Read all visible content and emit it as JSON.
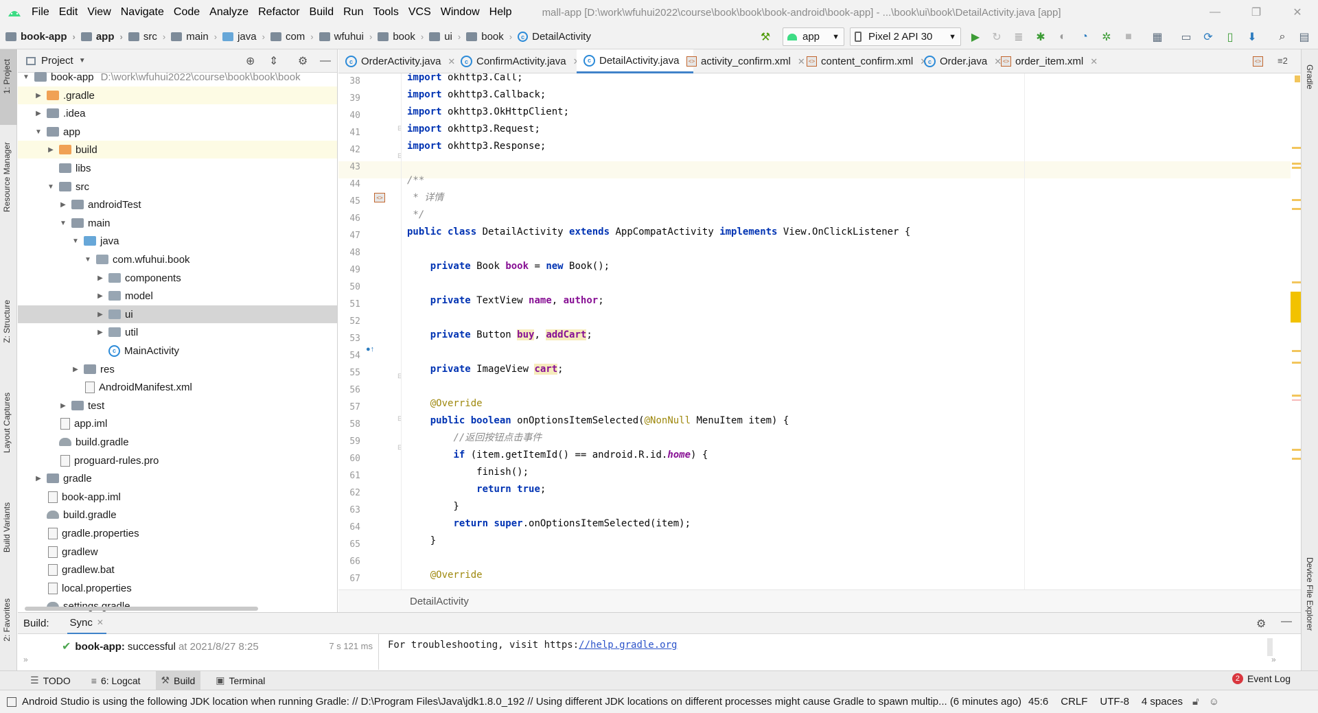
{
  "menu": {
    "items": [
      "File",
      "Edit",
      "View",
      "Navigate",
      "Code",
      "Analyze",
      "Refactor",
      "Build",
      "Run",
      "Tools",
      "VCS",
      "Window",
      "Help"
    ],
    "window_title": "mall-app [D:\\work\\wfuhui2022\\course\\book\\book\\book-android\\book-app] - ...\\book\\ui\\book\\DetailActivity.java [app]"
  },
  "navbar": {
    "crumbs": [
      "book-app",
      "app",
      "src",
      "main",
      "java",
      "com",
      "wfuhui",
      "book",
      "ui",
      "book",
      "DetailActivity"
    ],
    "run_config": "app",
    "device": "Pixel 2 API 30"
  },
  "left_stripe": {
    "tabs": [
      "1: Project",
      "Resource Manager",
      "Z: Structure",
      "Layout Captures",
      "Build Variants",
      "2: Favorites"
    ]
  },
  "right_stripe": {
    "tabs": [
      "Gradle",
      "Device File Explorer"
    ]
  },
  "project": {
    "title": "Project",
    "tree": [
      {
        "label": "book-app",
        "path": "D:\\work\\wfuhui2022\\course\\book\\book\\book",
        "depth": 0,
        "arrow": "open",
        "icon": "folder"
      },
      {
        "label": ".gradle",
        "depth": 1,
        "arrow": "closed",
        "icon": "folder-orange",
        "hl": "yellow"
      },
      {
        "label": ".idea",
        "depth": 1,
        "arrow": "closed",
        "icon": "folder"
      },
      {
        "label": "app",
        "depth": 1,
        "arrow": "open",
        "icon": "folder"
      },
      {
        "label": "build",
        "depth": 2,
        "arrow": "closed",
        "icon": "folder-orange",
        "hl": "yellow"
      },
      {
        "label": "libs",
        "depth": 2,
        "arrow": "none",
        "icon": "folder"
      },
      {
        "label": "src",
        "depth": 2,
        "arrow": "open",
        "icon": "folder"
      },
      {
        "label": "androidTest",
        "depth": 3,
        "arrow": "closed",
        "icon": "folder"
      },
      {
        "label": "main",
        "depth": 3,
        "arrow": "open",
        "icon": "folder"
      },
      {
        "label": "java",
        "depth": 4,
        "arrow": "open",
        "icon": "folder-blue"
      },
      {
        "label": "com.wfuhui.book",
        "depth": 5,
        "arrow": "open",
        "icon": "package"
      },
      {
        "label": "components",
        "depth": 6,
        "arrow": "closed",
        "icon": "package"
      },
      {
        "label": "model",
        "depth": 6,
        "arrow": "closed",
        "icon": "package"
      },
      {
        "label": "ui",
        "depth": 6,
        "arrow": "closed",
        "icon": "package",
        "hl": "selected"
      },
      {
        "label": "util",
        "depth": 6,
        "arrow": "closed",
        "icon": "package"
      },
      {
        "label": "MainActivity",
        "depth": 6,
        "arrow": "none",
        "icon": "class"
      },
      {
        "label": "res",
        "depth": 4,
        "arrow": "closed",
        "icon": "folder"
      },
      {
        "label": "AndroidManifest.xml",
        "depth": 4,
        "arrow": "none",
        "icon": "file"
      },
      {
        "label": "test",
        "depth": 3,
        "arrow": "closed",
        "icon": "folder"
      },
      {
        "label": "app.iml",
        "depth": 2,
        "arrow": "none",
        "icon": "file"
      },
      {
        "label": "build.gradle",
        "depth": 2,
        "arrow": "none",
        "icon": "gradle"
      },
      {
        "label": "proguard-rules.pro",
        "depth": 2,
        "arrow": "none",
        "icon": "file"
      },
      {
        "label": "gradle",
        "depth": 1,
        "arrow": "closed",
        "icon": "folder"
      },
      {
        "label": "book-app.iml",
        "depth": 1,
        "arrow": "none",
        "icon": "file"
      },
      {
        "label": "build.gradle",
        "depth": 1,
        "arrow": "none",
        "icon": "gradle"
      },
      {
        "label": "gradle.properties",
        "depth": 1,
        "arrow": "none",
        "icon": "file"
      },
      {
        "label": "gradlew",
        "depth": 1,
        "arrow": "none",
        "icon": "file"
      },
      {
        "label": "gradlew.bat",
        "depth": 1,
        "arrow": "none",
        "icon": "file"
      },
      {
        "label": "local.properties",
        "depth": 1,
        "arrow": "none",
        "icon": "file"
      },
      {
        "label": "settings.gradle",
        "depth": 1,
        "arrow": "none",
        "icon": "gradle"
      }
    ]
  },
  "editor": {
    "tabs": [
      {
        "label": "OrderActivity.java",
        "icon": "class",
        "active": false
      },
      {
        "label": "ConfirmActivity.java",
        "icon": "class",
        "active": false
      },
      {
        "label": "DetailActivity.java",
        "icon": "class",
        "active": true
      },
      {
        "label": "activity_confirm.xml",
        "icon": "xml",
        "active": false
      },
      {
        "label": "content_confirm.xml",
        "icon": "xml",
        "active": false
      },
      {
        "label": "Order.java",
        "icon": "class",
        "active": false
      },
      {
        "label": "order_item.xml",
        "icon": "xml",
        "active": false
      }
    ],
    "tab_overflow": "≡2",
    "line_numbers": [
      "38",
      "39",
      "40",
      "41",
      "42",
      "43",
      "44",
      "45",
      "46",
      "47",
      "48",
      "49",
      "50",
      "51",
      "52",
      "53",
      "54",
      "55",
      "56",
      "57",
      "58",
      "59",
      "60",
      "61",
      "62",
      "63",
      "64",
      "65",
      "66",
      "67"
    ],
    "breadcrumb": "DetailActivity"
  },
  "build": {
    "label": "Build:",
    "tab": "Sync",
    "result_project": "book-app:",
    "result_status": "successful",
    "result_time": "at 2021/8/27 8:25",
    "duration": "7 s 121 ms",
    "output_prefix": "For troubleshooting, visit https:",
    "output_link": "//help.gradle.org"
  },
  "tool_tabs": [
    "TODO",
    "6: Logcat",
    "Build",
    "Terminal"
  ],
  "event_log": {
    "count": "2",
    "label": "Event Log"
  },
  "status": {
    "message": "Android Studio is using the following JDK location when running Gradle: // D:\\Program Files\\Java\\jdk1.8.0_192 // Using different JDK locations on different processes might cause Gradle to spawn multip... (6 minutes ago)",
    "position": "45:6",
    "line_sep": "CRLF",
    "encoding": "UTF-8",
    "indent": "4 spaces"
  },
  "colors": {
    "keyword": "#0033b3",
    "field": "#871094",
    "comment": "#8c8c8c",
    "annotation": "#9e880d",
    "accent": "#4083c9"
  }
}
